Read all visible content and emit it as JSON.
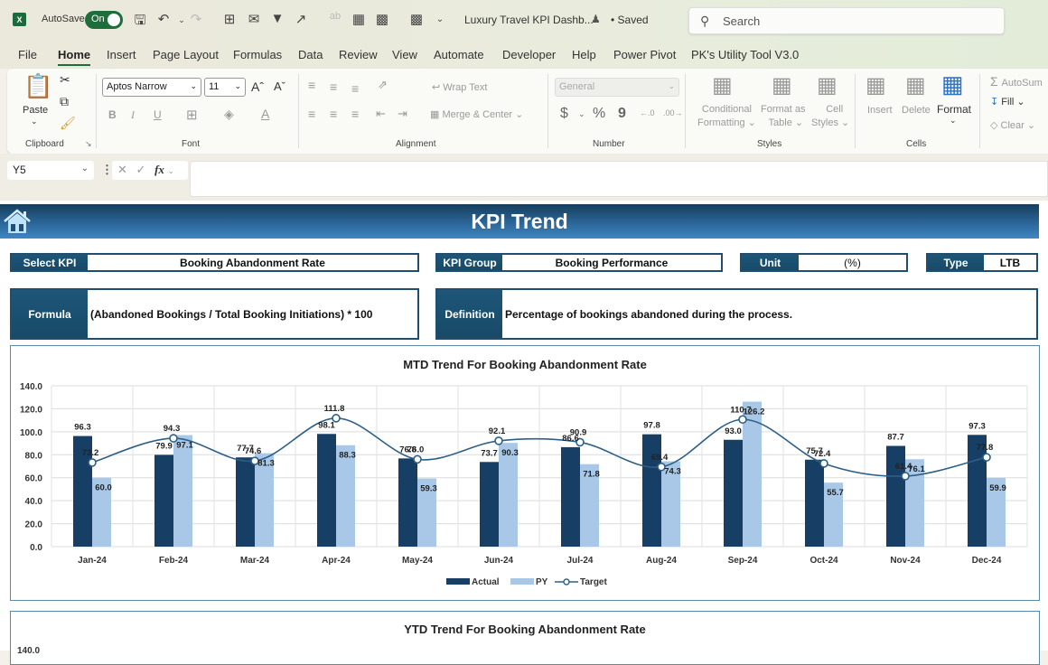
{
  "titlebar": {
    "app_icon": "excel-icon",
    "app_letter": "X",
    "autosave_label": "AutoSave",
    "autosave_state": "On",
    "qat_icons": [
      "save-icon",
      "undo-icon",
      "redo-icon",
      "borders-icon",
      "form-icon",
      "filter-icon",
      "share-icon",
      "spelling-icon",
      "table-icon",
      "calculator-icon",
      "calculator-icon",
      "customize-qat-icon"
    ],
    "document_title": "Luxury Travel KPI Dashb...",
    "save_status": "• Saved",
    "search_placeholder": "Search"
  },
  "menu": {
    "items": [
      "File",
      "Home",
      "Insert",
      "Page Layout",
      "Formulas",
      "Data",
      "Review",
      "View",
      "Automate",
      "Developer",
      "Help",
      "Power Pivot",
      "PK's Utility Tool V3.0"
    ],
    "active": "Home"
  },
  "ribbon": {
    "clipboard": {
      "label": "Clipboard",
      "paste": "Paste"
    },
    "font": {
      "label": "Font",
      "font_name": "Aptos Narrow",
      "font_size": "11",
      "bold": "B",
      "italic": "I",
      "underline": "U"
    },
    "alignment": {
      "label": "Alignment",
      "wrap_text": "Wrap Text",
      "merge_center": "Merge & Center"
    },
    "number": {
      "label": "Number",
      "format": "General",
      "currency": "$",
      "percent": "%",
      "comma": "9"
    },
    "styles": {
      "label": "Styles",
      "conditional_1": "Conditional",
      "conditional_2": "Formatting",
      "format_table_1": "Format as",
      "format_table_2": "Table",
      "cell_styles_1": "Cell",
      "cell_styles_2": "Styles"
    },
    "cells": {
      "label": "Cells",
      "insert": "Insert",
      "delete": "Delete",
      "format": "Format"
    },
    "editing": {
      "autosum": "AutoSum",
      "fill": "Fill",
      "clear": "Clear"
    }
  },
  "formula_bar": {
    "name_box": "Y5",
    "fx": "fx",
    "formula": ""
  },
  "dashboard": {
    "title": "KPI Trend",
    "select_kpi_label": "Select KPI",
    "select_kpi_value": "Booking Abandonment Rate",
    "kpi_group_label": "KPI Group",
    "kpi_group_value": "Booking Performance",
    "unit_label": "Unit",
    "unit_value": "(%)",
    "type_label": "Type",
    "type_value": "LTB",
    "formula_label": "Formula",
    "formula_value": "(Abandoned Bookings / Total Booking Initiations) * 100",
    "definition_label": "Definition",
    "definition_value": "Percentage of bookings abandoned during the process."
  },
  "colors": {
    "actual": "#173f66",
    "py": "#a9c8e8",
    "target": "#2e5f86",
    "header_dark": "#1d5678"
  },
  "chart_data": [
    {
      "type": "bar",
      "title": "MTD Trend For Booking Abandonment Rate",
      "categories": [
        "Jan-24",
        "Feb-24",
        "Mar-24",
        "Apr-24",
        "May-24",
        "Jun-24",
        "Jul-24",
        "Aug-24",
        "Sep-24",
        "Oct-24",
        "Nov-24",
        "Dec-24"
      ],
      "series": [
        {
          "name": "Actual",
          "type": "bar",
          "values": [
            96.3,
            79.9,
            77.7,
            98.1,
            76.8,
            73.7,
            86.6,
            97.8,
            93.0,
            75.7,
            87.7,
            97.3
          ]
        },
        {
          "name": "PY",
          "type": "bar",
          "values": [
            60.0,
            97.1,
            81.3,
            88.3,
            59.3,
            90.3,
            71.8,
            74.3,
            126.2,
            55.7,
            76.1,
            59.9
          ]
        },
        {
          "name": "Target",
          "type": "line",
          "values": [
            73.2,
            94.3,
            74.6,
            111.8,
            76.0,
            92.1,
            90.9,
            69.4,
            110.7,
            72.4,
            61.4,
            77.8
          ]
        }
      ],
      "yticks": [
        "0.0",
        "20.0",
        "40.0",
        "60.0",
        "80.0",
        "100.0",
        "120.0",
        "140.0"
      ],
      "ylim": [
        0,
        140
      ],
      "xlabel": "",
      "ylabel": "",
      "grid": true,
      "legend": "bottom"
    },
    {
      "type": "bar",
      "title": "YTD Trend For Booking Abandonment Rate",
      "yticks": [
        "140.0"
      ]
    }
  ]
}
